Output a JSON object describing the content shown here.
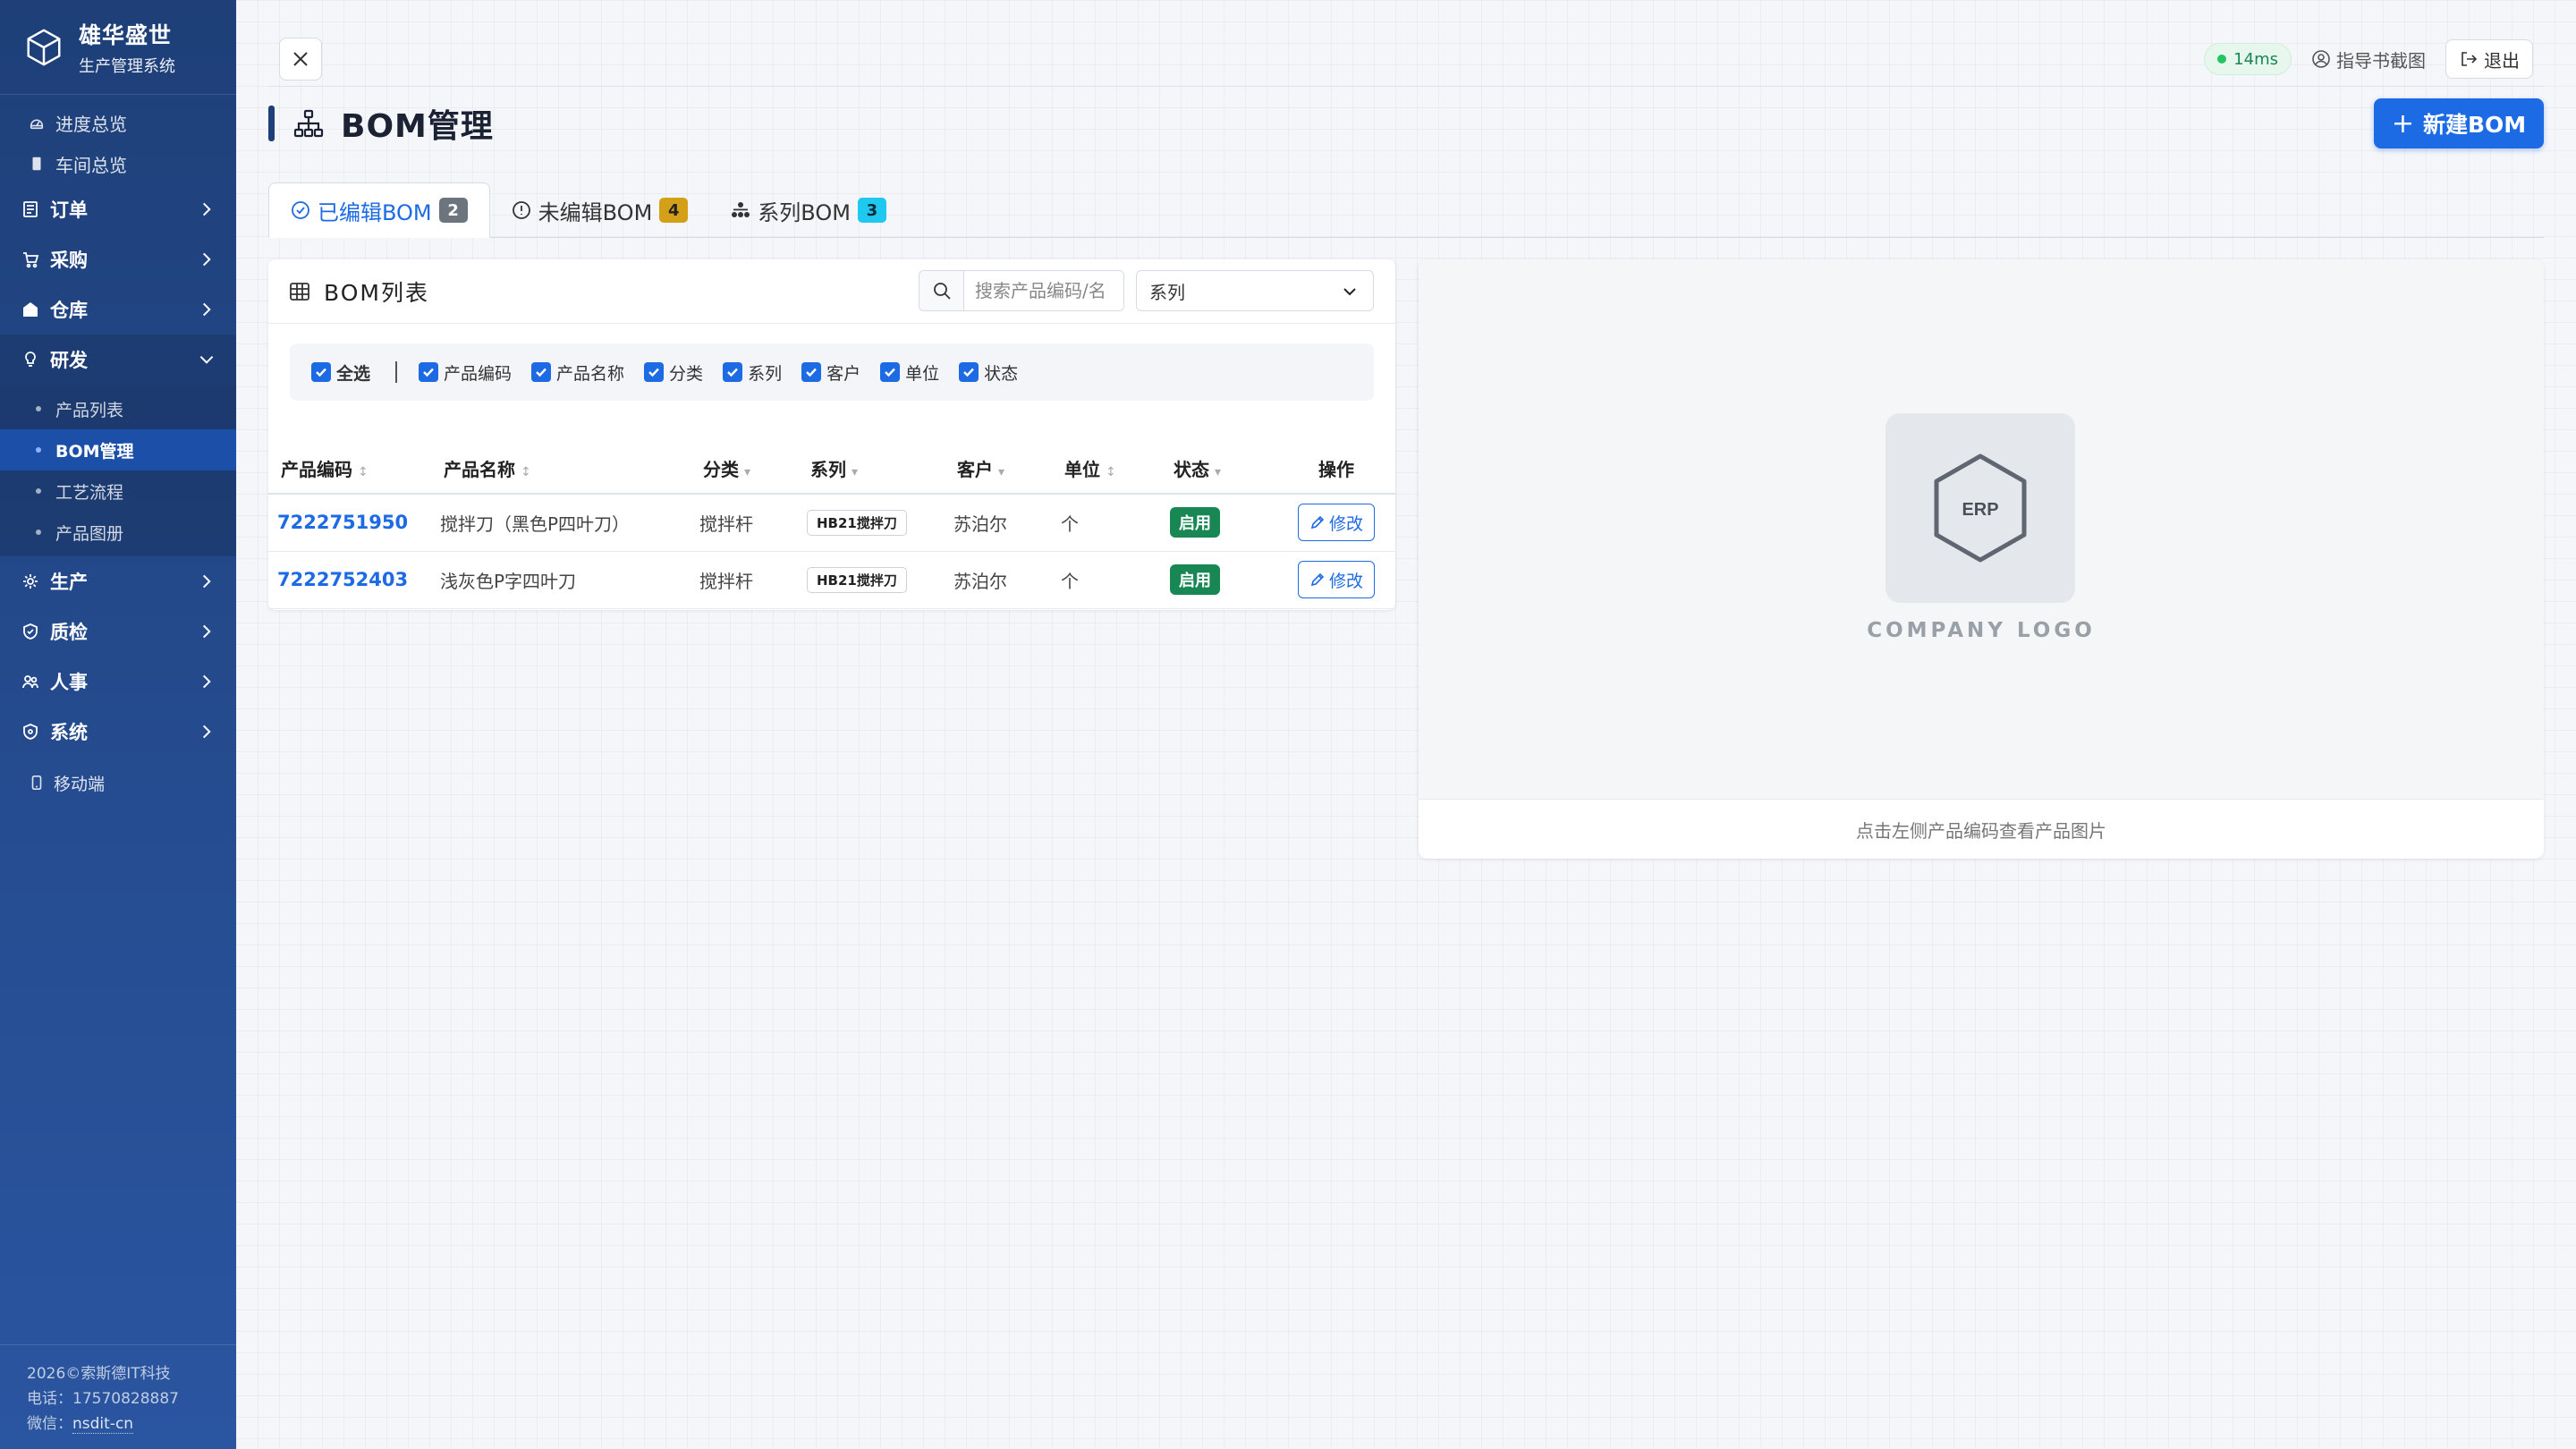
{
  "brand": {
    "title": "雄华盛世",
    "subtitle": "生产管理系统"
  },
  "sidebar": {
    "top_items": [
      {
        "label": "进度总览",
        "icon": "dashboard-icon"
      },
      {
        "label": "车间总览",
        "icon": "building-icon"
      }
    ],
    "groups": [
      {
        "label": "订单",
        "icon": "order-icon",
        "open": false
      },
      {
        "label": "采购",
        "icon": "cart-icon",
        "open": false
      },
      {
        "label": "仓库",
        "icon": "warehouse-icon",
        "open": false
      },
      {
        "label": "研发",
        "icon": "lightbulb-icon",
        "open": true
      },
      {
        "label": "生产",
        "icon": "gear-icon",
        "open": false
      },
      {
        "label": "质检",
        "icon": "shield-check-icon",
        "open": false
      },
      {
        "label": "人事",
        "icon": "people-icon",
        "open": false
      },
      {
        "label": "系统",
        "icon": "shield-icon",
        "open": false
      }
    ],
    "rd_subitems": [
      "产品列表",
      "BOM管理",
      "工艺流程",
      "产品图册"
    ],
    "active_subitem": "BOM管理",
    "mobile_link": "移动端",
    "footer": {
      "copyright": "2026©索斯德IT科技",
      "phone_label": "电话：",
      "phone": "17570828887",
      "wechat_label": "微信：",
      "wechat": "nsdit-cn"
    }
  },
  "topbar": {
    "latency": "14ms",
    "guide": "指导书截图",
    "logout": "退出"
  },
  "page": {
    "title": "BOM管理",
    "new_button": "新建BOM"
  },
  "tabs": [
    {
      "label": "已编辑BOM",
      "count": "2",
      "active": true,
      "icon": "check-circle-icon",
      "badge_color": "#6c757d"
    },
    {
      "label": "未编辑BOM",
      "count": "4",
      "active": false,
      "icon": "alert-circle-icon",
      "badge_color": "#d4a017"
    },
    {
      "label": "系列BOM",
      "count": "3",
      "active": false,
      "icon": "hierarchy-icon",
      "badge_color": "#1ec8ee"
    }
  ],
  "list": {
    "title": "BOM列表",
    "search_placeholder": "搜索产品编码/名",
    "series_select": "系列",
    "columns_toggle": [
      "全选",
      "产品编码",
      "产品名称",
      "分类",
      "系列",
      "客户",
      "单位",
      "状态"
    ],
    "headers": [
      "产品编码",
      "产品名称",
      "分类",
      "系列",
      "客户",
      "单位",
      "状态",
      "操作"
    ],
    "rows": [
      {
        "code": "7222751950",
        "name": "搅拌刀（黑色P四叶刀）",
        "category": "搅拌杆",
        "series": "HB21搅拌刀",
        "customer": "苏泊尔",
        "unit": "个",
        "status": "启用",
        "action": "修改"
      },
      {
        "code": "7222752403",
        "name": "浅灰色P字四叶刀",
        "category": "搅拌杆",
        "series": "HB21搅拌刀",
        "customer": "苏泊尔",
        "unit": "个",
        "status": "启用",
        "action": "修改"
      }
    ]
  },
  "logo_panel": {
    "logo_text": "ERP",
    "caption": "COMPANY LOGO",
    "hint": "点击左侧产品编码查看产品图片"
  },
  "colors": {
    "accent": "#1d6ae5",
    "sidebar": "#244a8c",
    "success": "#198754"
  }
}
